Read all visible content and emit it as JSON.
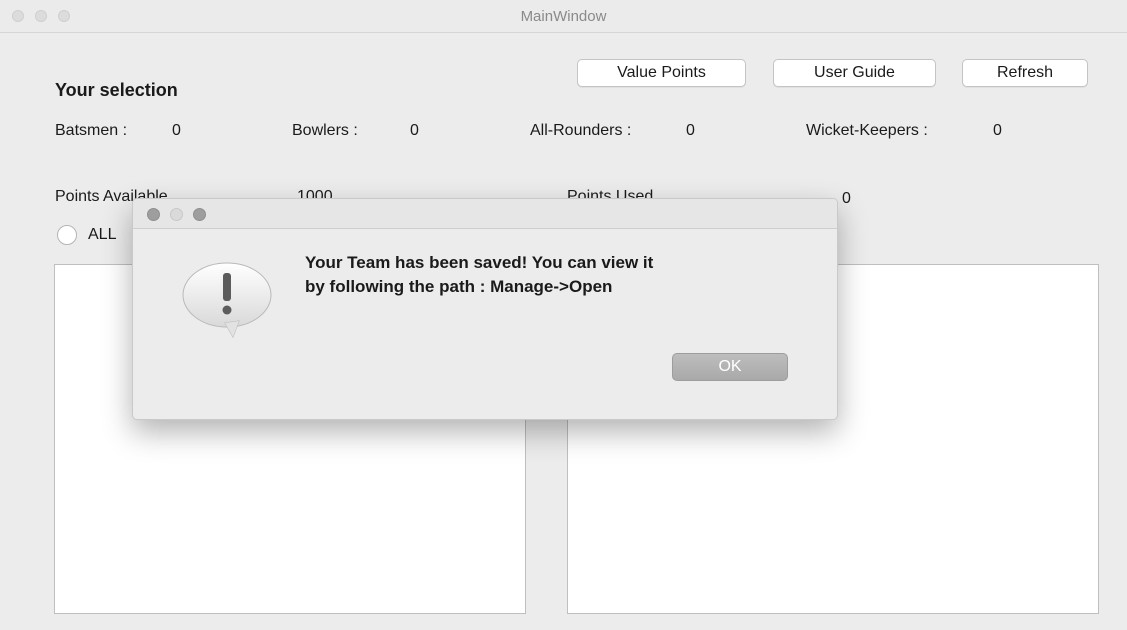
{
  "window": {
    "title": "MainWindow"
  },
  "toolbar": {
    "value_points_label": "Value Points",
    "user_guide_label": "User Guide",
    "refresh_label": "Refresh"
  },
  "selection": {
    "heading": "Your selection",
    "batsmen_label": "Batsmen :",
    "batsmen_value": "0",
    "bowlers_label": "Bowlers :",
    "bowlers_value": "0",
    "allrounders_label": "All-Rounders :",
    "allrounders_value": "0",
    "wicketkeepers_label": "Wicket-Keepers :",
    "wicketkeepers_value": "0"
  },
  "points": {
    "available_label": "Points Available",
    "available_value": "1000",
    "used_label": "Points Used",
    "used_value": "0"
  },
  "filters": {
    "all_label": "ALL"
  },
  "dialog": {
    "message_line1": "Your Team has been saved! You can view it",
    "message_line2": "by following the path : Manage->Open",
    "ok_label": "OK",
    "icon": "warning-exclamation-icon"
  },
  "colors": {
    "window_bg": "#ececec",
    "ok_button": "#b1b1b1"
  }
}
